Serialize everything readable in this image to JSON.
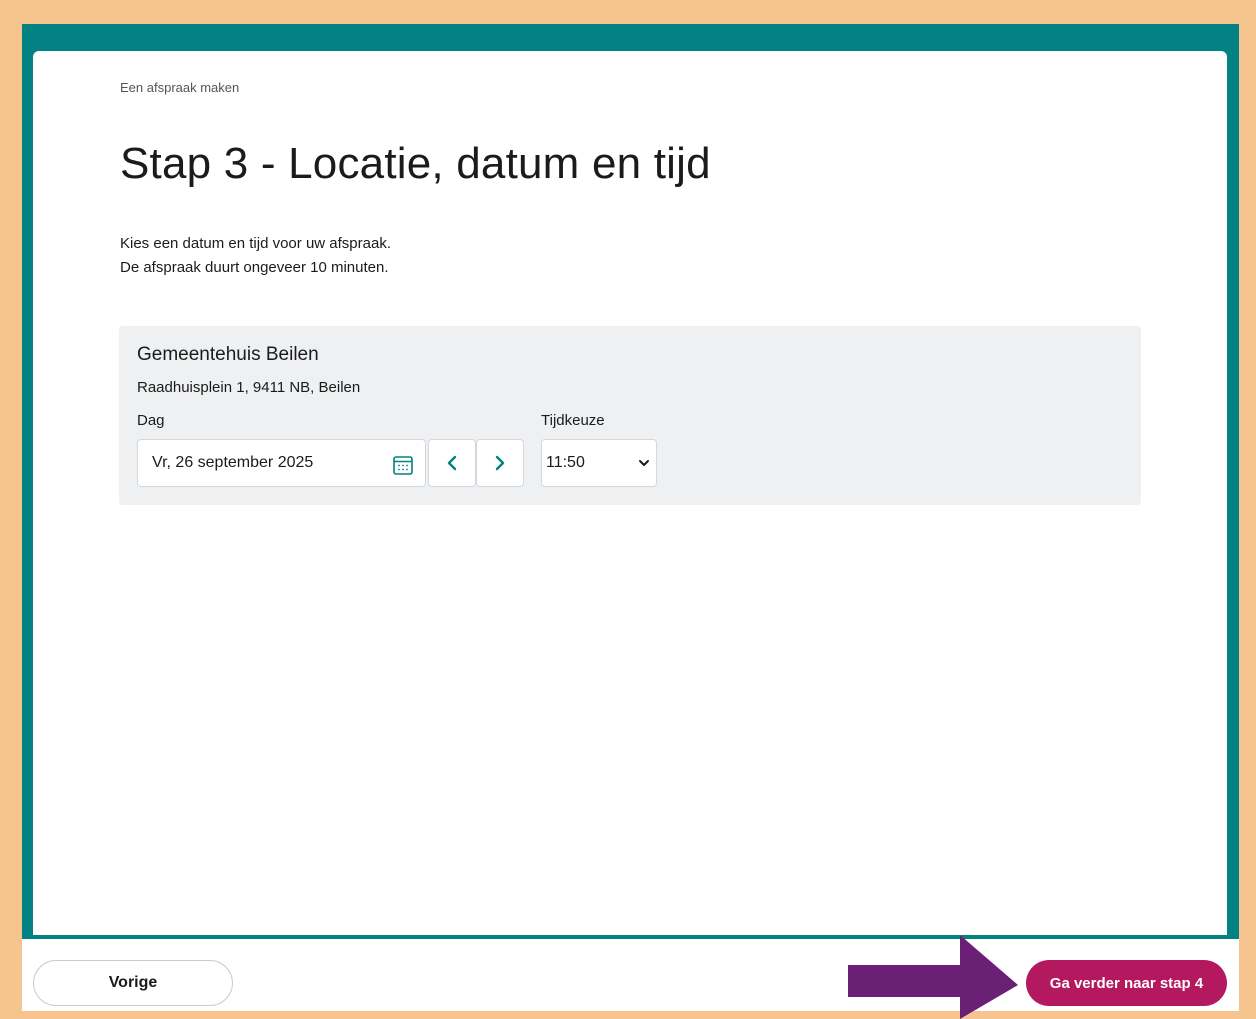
{
  "breadcrumb": "Een afspraak maken",
  "title": "Stap 3 - Locatie, datum en tijd",
  "intro": {
    "line1": "Kies een datum en tijd voor uw afspraak.",
    "line2": "De afspraak duurt ongeveer 10 minuten."
  },
  "location": {
    "name": "Gemeentehuis Beilen",
    "address": "Raadhuisplein 1, 9411 NB, Beilen",
    "day_label": "Dag",
    "day_value": "Vr, 26 september 2025",
    "time_label": "Tijdkeuze",
    "time_value": "11:50"
  },
  "footer": {
    "prev_label": "Vorige",
    "next_label": "Ga verder naar stap 4"
  },
  "colors": {
    "teal": "#028283",
    "accent": "#b4185f",
    "arrow": "#6a2175",
    "border_outer": "#f6c48f"
  }
}
